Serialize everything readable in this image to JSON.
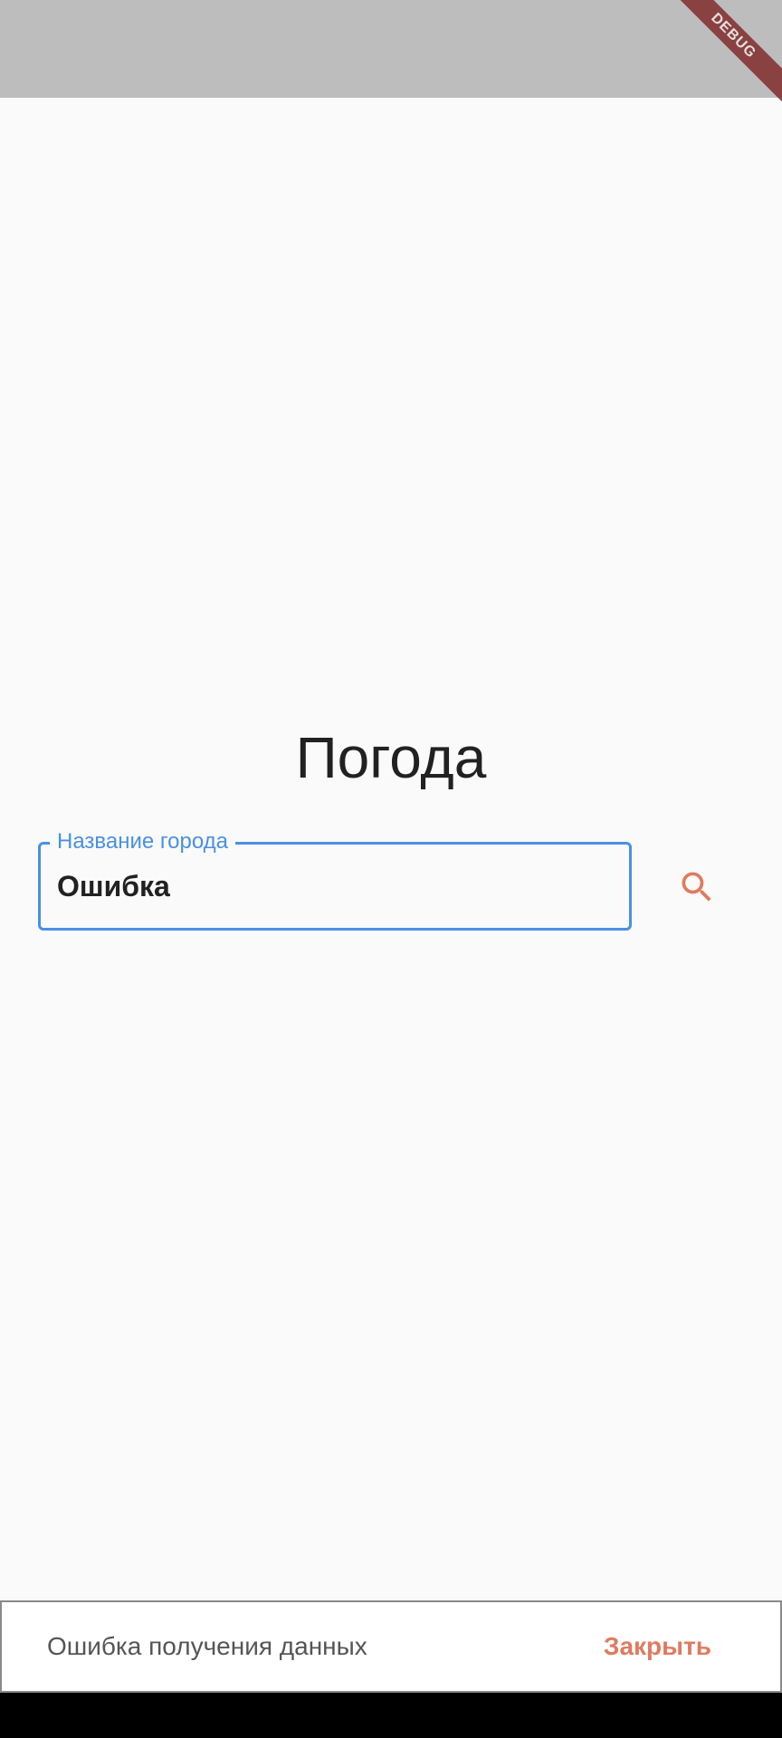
{
  "debug_banner": {
    "label": "DEBUG"
  },
  "page": {
    "title": "Погода"
  },
  "search": {
    "label": "Название города",
    "value": "Ошибка",
    "search_icon": "search-icon"
  },
  "snackbar": {
    "message": "Ошибка получения данных",
    "action_label": "Закрыть"
  },
  "colors": {
    "accent": "#4a90e2",
    "action": "#e07a5f",
    "status_bar": "#bdbdbd",
    "background": "#fafafa"
  }
}
